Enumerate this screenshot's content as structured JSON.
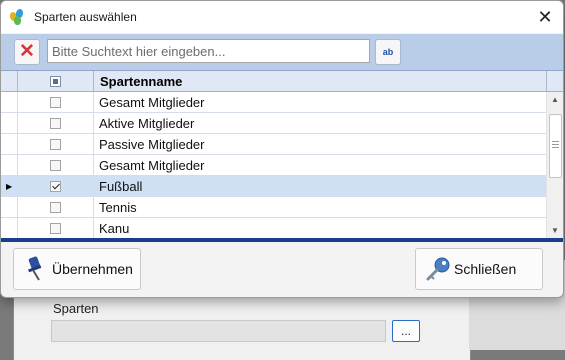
{
  "dialog": {
    "title": "Sparten auswählen",
    "close_label": "✕"
  },
  "search": {
    "placeholder": "Bitte Suchtext hier eingeben...",
    "value": "",
    "clear_label": "✕",
    "search_label": "ab"
  },
  "grid": {
    "column_name": "Spartenname",
    "rows": [
      {
        "name": "Gesamt Mitglieder",
        "checked": false
      },
      {
        "name": "Aktive Mitglieder",
        "checked": false
      },
      {
        "name": "Passive Mitglieder",
        "checked": false
      },
      {
        "name": "Gesamt Mitglieder",
        "checked": false
      },
      {
        "name": "Fußball",
        "checked": true,
        "current": true
      },
      {
        "name": "Tennis",
        "checked": false
      },
      {
        "name": "Kanu",
        "checked": false
      }
    ]
  },
  "buttons": {
    "apply_label": "Übernehmen",
    "close_label": "Schließen"
  },
  "background": {
    "label": "Sparten",
    "dots_label": "..."
  },
  "colors": {
    "accent": "#1b3d8c",
    "searchbar": "#b9cde8",
    "selected_row": "#cfe0f5"
  },
  "icons": {
    "app": "app-logo-icon",
    "clear": "clear-x-icon",
    "search": "spellcheck-search-icon",
    "apply": "pushpin-icon",
    "close": "key-icon"
  }
}
